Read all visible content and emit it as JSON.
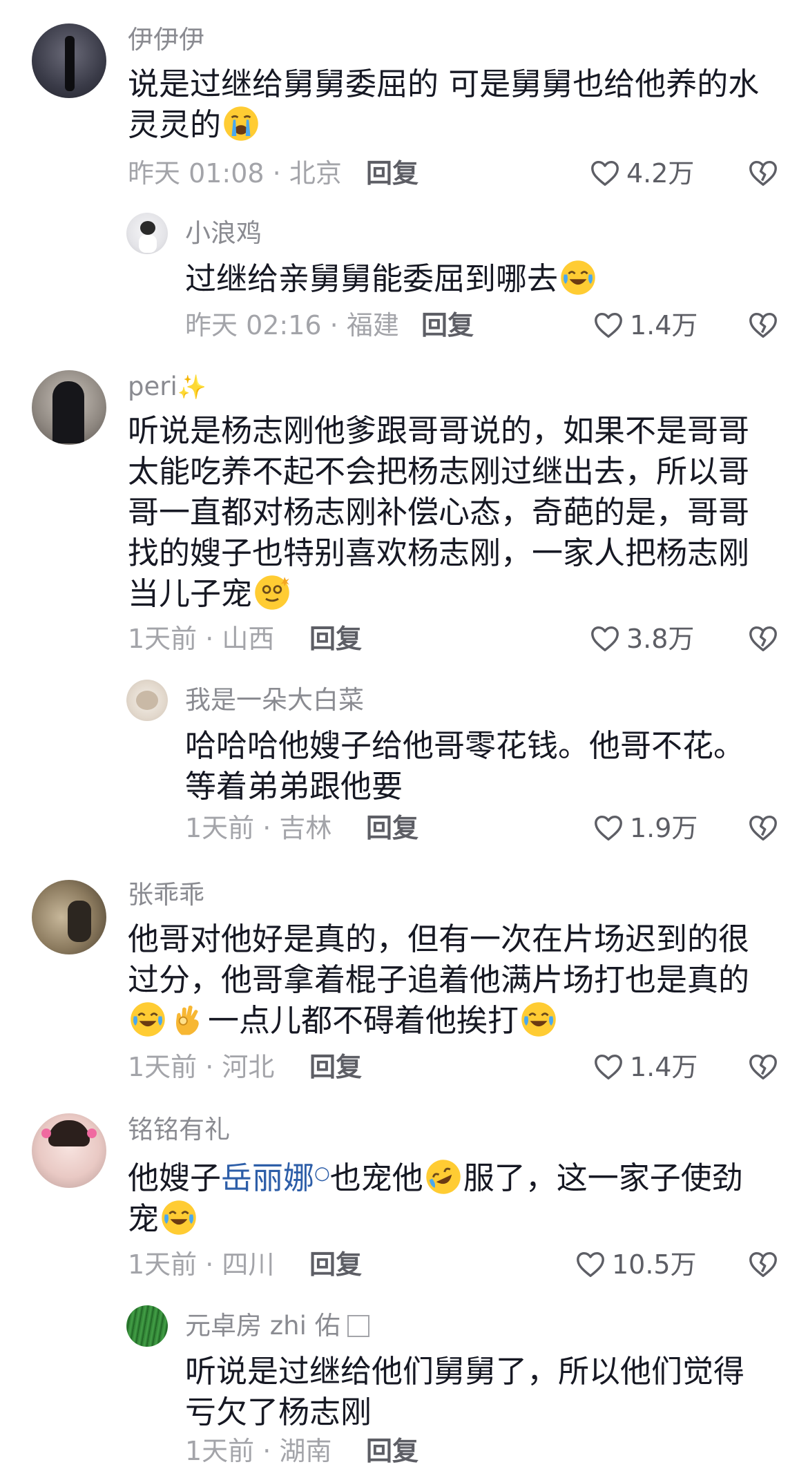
{
  "colors": {
    "text": "#161823",
    "secondary": "#a3a4a9",
    "action": "#5d5e65",
    "mention": "#2d5ea8"
  },
  "comments": [
    {
      "username": "伊伊伊",
      "text_1": "说是过继给舅舅委屈的 可是舅舅也给他养的水灵灵的",
      "emoji": "loudly-crying-face",
      "time": "昨天 01:08 · 北京",
      "reply_label": "回复",
      "likes": "4.2万"
    },
    {
      "username": "小浪鸡",
      "text_1": "过继给亲舅舅能委屈到哪去",
      "emoji": "tears-of-joy-face",
      "time": "昨天 02:16 · 福建",
      "reply_label": "回复",
      "likes": "1.4万"
    },
    {
      "username": "peri",
      "username_suffix": "✨",
      "text_1": "听说是杨志刚他爹跟哥哥说的，如果不是哥哥太能吃养不起不会把杨志刚过继出去，所以哥哥一直都对杨志刚补偿心态，奇葩的是，哥哥找的嫂子也特别喜欢杨志刚，一家人把杨志刚当儿子宠",
      "emoji": "dizzy-face",
      "time": "1天前 · 山西",
      "reply_label": "回复",
      "likes": "3.8万"
    },
    {
      "username": "我是一朵大白菜",
      "text_1": "哈哈哈他嫂子给他哥零花钱。他哥不花。等着弟弟跟他要",
      "time": "1天前 · 吉林",
      "reply_label": "回复",
      "likes": "1.9万"
    },
    {
      "username": "张乖乖",
      "text_1": "他哥对他好是真的，但有一次在片场迟到的很过分，他哥拿着棍子追着他满片场打也是真的",
      "text_2": "一点儿都不碍着他挨打",
      "emoji": "tears-of-joy-face",
      "emoji_2": "ok-hand",
      "time": "1天前 · 河北",
      "reply_label": "回复",
      "likes": "1.4万"
    },
    {
      "username": "铭铭有礼",
      "text_pre": "他嫂子",
      "mention": "岳丽娜",
      "text_mid": "也宠他",
      "text_post": "服了，这一家子使劲宠",
      "emoji": "rolling-laughing-face",
      "emoji_2": "tears-of-joy-face",
      "time": "1天前 · 四川",
      "reply_label": "回复",
      "likes": "10.5万"
    },
    {
      "username": "元卓房 zhi 佑",
      "text_1": "听说是过继给他们舅舅了，所以他们觉得亏欠了杨志刚",
      "time": "1天前 · 湖南",
      "reply_label": "回复"
    }
  ]
}
